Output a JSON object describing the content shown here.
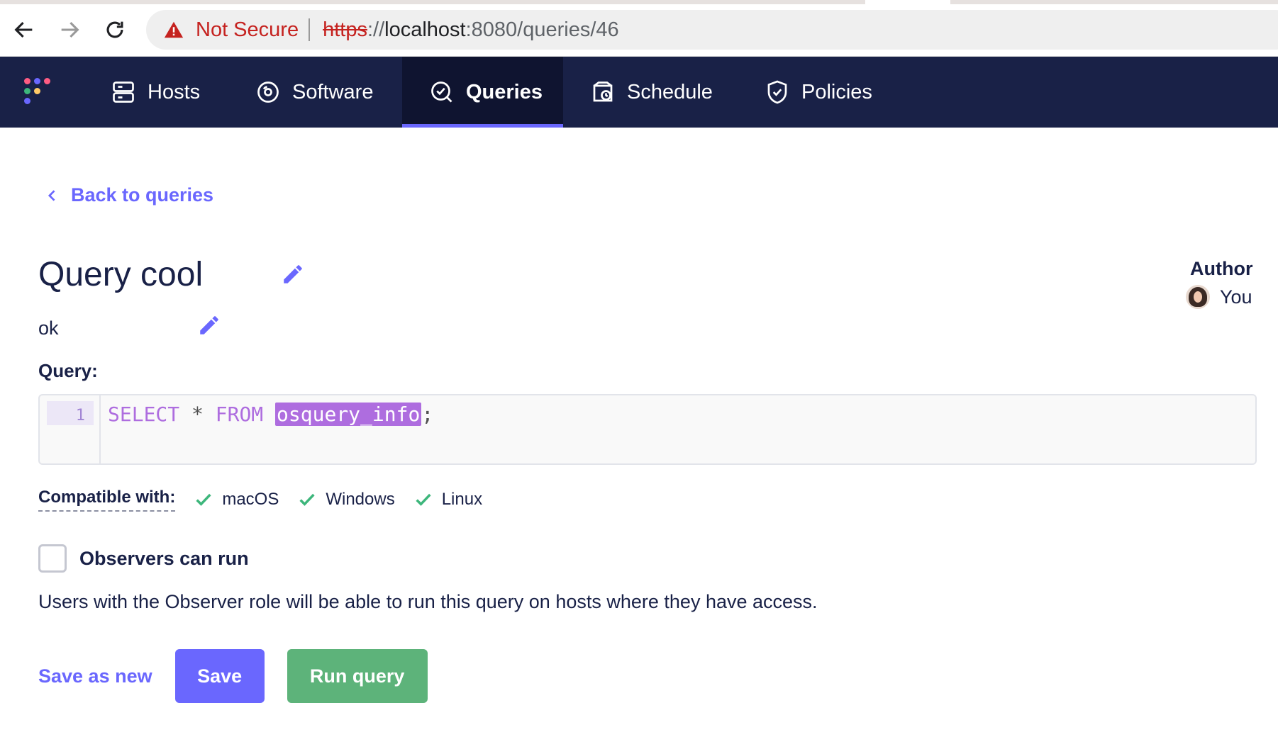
{
  "browser": {
    "security_label": "Not Secure",
    "url_scheme": "https",
    "url_separator": "://",
    "url_host": "localhost",
    "url_path": ":8080/queries/46",
    "icons": [
      "back-arrow-icon",
      "forward-arrow-icon",
      "reload-icon",
      "warning-icon"
    ]
  },
  "nav": {
    "items": [
      {
        "label": "Hosts",
        "icon": "hosts-icon"
      },
      {
        "label": "Software",
        "icon": "software-icon"
      },
      {
        "label": "Queries",
        "icon": "queries-icon",
        "active": true
      },
      {
        "label": "Schedule",
        "icon": "schedule-icon"
      },
      {
        "label": "Policies",
        "icon": "policies-icon"
      }
    ],
    "accent": "#6a67fe",
    "background": "#192147"
  },
  "page": {
    "back_label": "Back to queries",
    "title": "Query cool",
    "description": "ok",
    "author_label": "Author",
    "author_name": "You",
    "query_label": "Query:",
    "editor": {
      "line_number": "1",
      "kw_select": "SELECT",
      "star": " * ",
      "kw_from": "FROM",
      "table": "osquery_info",
      "terminator": ";"
    },
    "compatible_label": "Compatible with:",
    "platforms": [
      "macOS",
      "Windows",
      "Linux"
    ],
    "observer_label": "Observers can run",
    "observer_help": "Users with the Observer role will be able to run this query on hosts where they have access.",
    "observer_checked": false,
    "save_as_new_label": "Save as new",
    "save_label": "Save",
    "run_label": "Run query"
  },
  "colors": {
    "primary": "#6a67fe",
    "success": "#5db37a",
    "text": "#192147",
    "keyword": "#ae6ddf"
  }
}
